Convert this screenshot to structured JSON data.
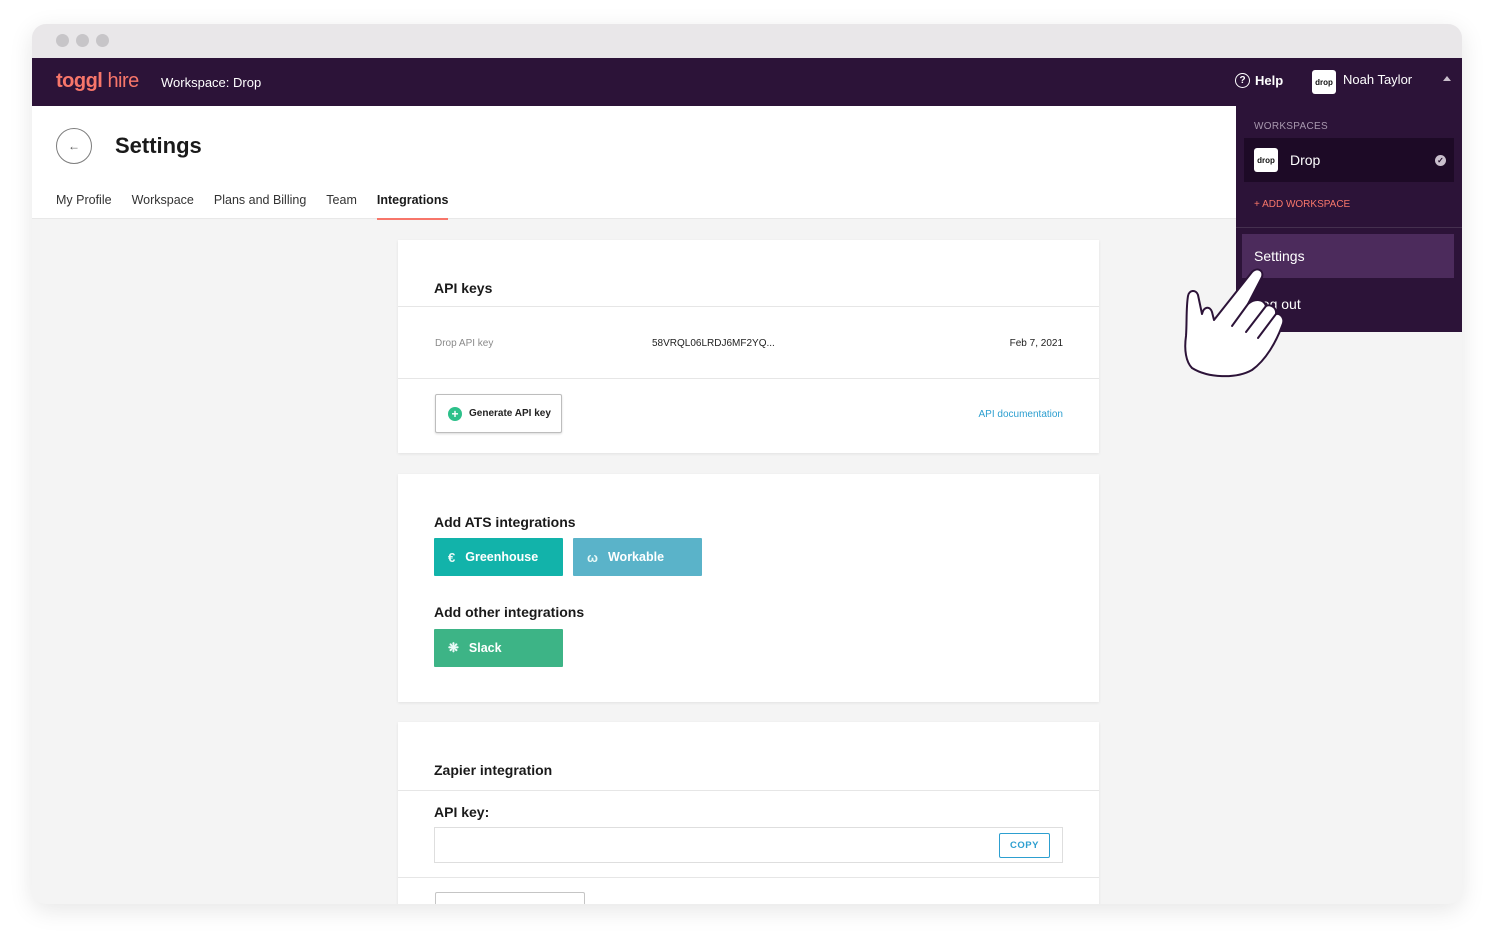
{
  "app": {
    "logo_toggl": "toggl",
    "logo_hire": "hire",
    "workspace_label": "Workspace: Drop",
    "help_label": "Help",
    "user_name": "Noah Taylor",
    "avatar_text": "drop"
  },
  "header": {
    "title": "Settings",
    "tabs": [
      {
        "label": "My Profile",
        "active": false
      },
      {
        "label": "Workspace",
        "active": false
      },
      {
        "label": "Plans and Billing",
        "active": false
      },
      {
        "label": "Team",
        "active": false
      },
      {
        "label": "Integrations",
        "active": true
      }
    ]
  },
  "api_keys": {
    "title": "API keys",
    "rows": [
      {
        "label": "Drop API key",
        "value": "58VRQL06LRDJ6MF2YQ...",
        "date": "Feb 7, 2021"
      }
    ],
    "generate_label": "Generate API key",
    "doc_link": "API documentation"
  },
  "integrations": {
    "ats_title": "Add ATS integrations",
    "ats": [
      {
        "label": "Greenhouse",
        "icon": "greenhouse-icon",
        "color": "#12b3aa"
      },
      {
        "label": "Workable",
        "icon": "workable-icon",
        "color": "#5ab3c9"
      }
    ],
    "other_title": "Add other integrations",
    "other": [
      {
        "label": "Slack",
        "icon": "slack-icon",
        "color": "#3db486"
      }
    ]
  },
  "zapier": {
    "title": "Zapier integration",
    "api_key_label": "API key:",
    "api_key_value": "",
    "copy_label": "COPY"
  },
  "dropdown": {
    "section_label": "WORKSPACES",
    "workspace_name": "Drop",
    "workspace_avatar": "drop",
    "add_workspace": "+ ADD WORKSPACE",
    "items": [
      {
        "label": "Settings",
        "highlighted": true
      },
      {
        "label": "Log out",
        "highlighted": false
      }
    ]
  },
  "colors": {
    "topbar": "#2c1338",
    "accent": "#f7766a",
    "link": "#2d9fd0"
  }
}
